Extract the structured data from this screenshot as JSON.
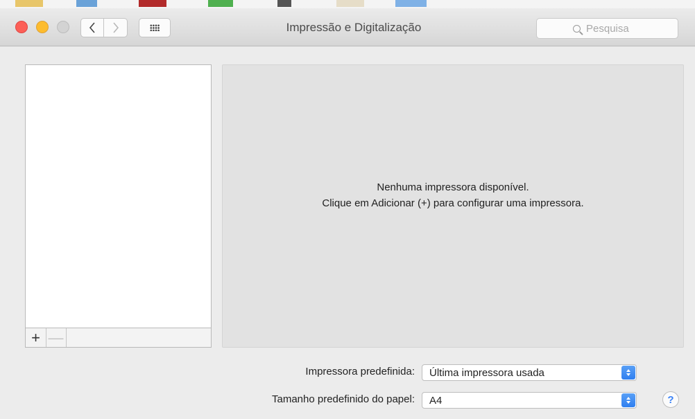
{
  "window": {
    "title": "Impressão e Digitalização"
  },
  "toolbar": {
    "back_icon": "chevron-left-icon",
    "forward_icon": "chevron-right-icon",
    "show_all_icon": "grid-icon",
    "search_placeholder": "Pesquisa"
  },
  "printer_list": {
    "items": [],
    "add_label": "+",
    "remove_label": "—"
  },
  "detail": {
    "empty_line1": "Nenhuma impressora disponível.",
    "empty_line2": "Clique em Adicionar (+) para configurar uma impressora."
  },
  "settings": {
    "default_printer_label": "Impressora predefinida:",
    "default_printer_value": "Última impressora usada",
    "paper_size_label": "Tamanho predefinido do papel:",
    "paper_size_value": "A4"
  },
  "help_label": "?",
  "colors": {
    "close": "#fc5f57",
    "minimize": "#fdbc2e",
    "zoom_disabled": "#d3d3d3",
    "accent": "#2f7ff0"
  }
}
